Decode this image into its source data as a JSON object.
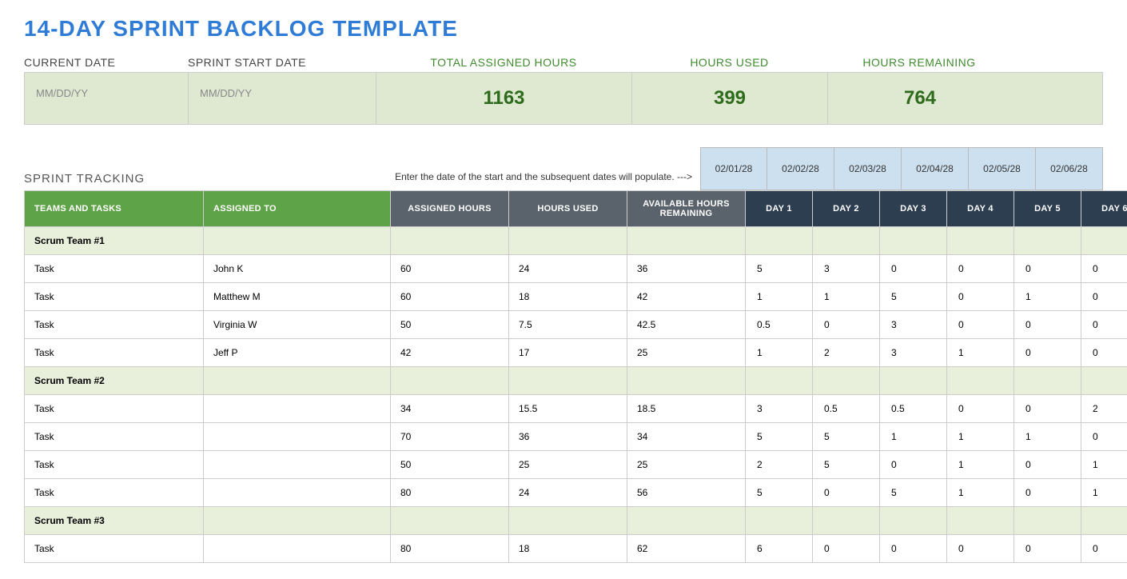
{
  "title": "14-DAY SPRINT BACKLOG TEMPLATE",
  "summary": {
    "labels": {
      "current_date": "CURRENT DATE",
      "start_date": "SPRINT START DATE",
      "total": "TOTAL ASSIGNED HOURS",
      "used": "HOURS USED",
      "remain": "HOURS REMAINING"
    },
    "current_date": "MM/DD/YY",
    "start_date": "MM/DD/YY",
    "total": "1163",
    "used": "399",
    "remain": "764"
  },
  "tracking_label": "SPRINT TRACKING",
  "hint": "Enter the date of the start and the subsequent dates will populate.  --->",
  "dates": [
    "02/01/28",
    "02/02/28",
    "02/03/28",
    "02/04/28",
    "02/05/28",
    "02/06/28"
  ],
  "headers": {
    "teams": "TEAMS AND TASKS",
    "assigned_to": "ASSIGNED TO",
    "assigned_hours": "ASSIGNED HOURS",
    "hours_used": "HOURS USED",
    "avail": "AVAILABLE HOURS REMAINING",
    "days": [
      "DAY 1",
      "DAY 2",
      "DAY 3",
      "DAY 4",
      "DAY 5",
      "DAY 6"
    ]
  },
  "rows": [
    {
      "type": "team",
      "task": "Scrum Team #1"
    },
    {
      "type": "task",
      "task": "Task",
      "assigned": "John K",
      "hours": "60",
      "used": "24",
      "remain": "36",
      "days": [
        "5",
        "3",
        "0",
        "0",
        "0",
        "0"
      ]
    },
    {
      "type": "task",
      "task": "Task",
      "assigned": "Matthew M",
      "hours": "60",
      "used": "18",
      "remain": "42",
      "days": [
        "1",
        "1",
        "5",
        "0",
        "1",
        "0"
      ]
    },
    {
      "type": "task",
      "task": "Task",
      "assigned": "Virginia W",
      "hours": "50",
      "used": "7.5",
      "remain": "42.5",
      "days": [
        "0.5",
        "0",
        "3",
        "0",
        "0",
        "0"
      ]
    },
    {
      "type": "task",
      "task": "Task",
      "assigned": "Jeff P",
      "hours": "42",
      "used": "17",
      "remain": "25",
      "days": [
        "1",
        "2",
        "3",
        "1",
        "0",
        "0"
      ]
    },
    {
      "type": "team",
      "task": "Scrum Team #2"
    },
    {
      "type": "task",
      "task": "Task",
      "assigned": "",
      "hours": "34",
      "used": "15.5",
      "remain": "18.5",
      "days": [
        "3",
        "0.5",
        "0.5",
        "0",
        "0",
        "2"
      ]
    },
    {
      "type": "task",
      "task": "Task",
      "assigned": "",
      "hours": "70",
      "used": "36",
      "remain": "34",
      "days": [
        "5",
        "5",
        "1",
        "1",
        "1",
        "0"
      ]
    },
    {
      "type": "task",
      "task": "Task",
      "assigned": "",
      "hours": "50",
      "used": "25",
      "remain": "25",
      "days": [
        "2",
        "5",
        "0",
        "1",
        "0",
        "1"
      ]
    },
    {
      "type": "task",
      "task": "Task",
      "assigned": "",
      "hours": "80",
      "used": "24",
      "remain": "56",
      "days": [
        "5",
        "0",
        "5",
        "1",
        "0",
        "1"
      ]
    },
    {
      "type": "team",
      "task": "Scrum Team #3"
    },
    {
      "type": "task",
      "task": "Task",
      "assigned": "",
      "hours": "80",
      "used": "18",
      "remain": "62",
      "days": [
        "6",
        "0",
        "0",
        "0",
        "0",
        "0"
      ]
    }
  ]
}
